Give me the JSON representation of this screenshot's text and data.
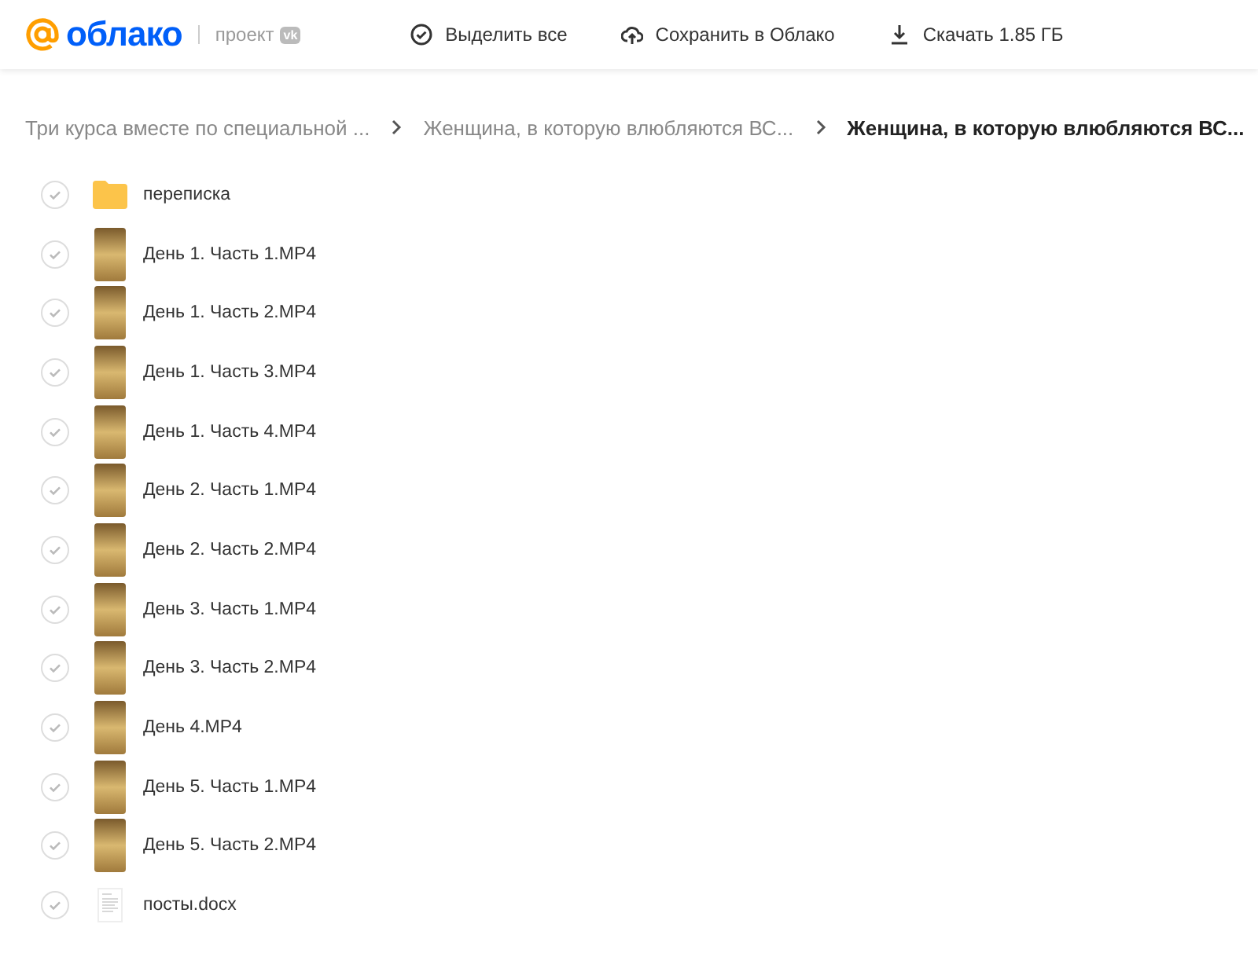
{
  "header": {
    "logo_text": "облако",
    "logo_sub": "проект",
    "vk_badge": "vk",
    "actions": [
      {
        "kind": "select",
        "label": "Выделить все"
      },
      {
        "kind": "save",
        "label": "Сохранить в Облако"
      },
      {
        "kind": "download",
        "label": "Скачать 1.85 ГБ"
      }
    ]
  },
  "breadcrumbs": [
    {
      "label": "Три курса вместе по специальной ...",
      "selected": false
    },
    {
      "label": "Женщина, в которую влюбляются ВС...",
      "selected": false
    },
    {
      "label": "Женщина, в которую влюбляются ВС...",
      "selected": true
    }
  ],
  "files": [
    {
      "kind": "folder",
      "name": "переписка",
      "selected": false
    },
    {
      "kind": "video",
      "name": "День 1. Часть 1.MP4",
      "selected": false
    },
    {
      "kind": "video",
      "name": "День 1. Часть 2.MP4",
      "selected": false
    },
    {
      "kind": "video",
      "name": "День 1. Часть 3.MP4",
      "selected": false
    },
    {
      "kind": "video",
      "name": "День 1. Часть 4.MP4",
      "selected": false
    },
    {
      "kind": "video",
      "name": "День 2. Часть 1.MP4",
      "selected": false
    },
    {
      "kind": "video",
      "name": "День 2. Часть 2.MP4",
      "selected": false
    },
    {
      "kind": "video",
      "name": "День 3. Часть 1.MP4",
      "selected": false
    },
    {
      "kind": "video",
      "name": "День 3. Часть 2.MP4",
      "selected": false
    },
    {
      "kind": "video",
      "name": "День 4.MP4",
      "selected": false
    },
    {
      "kind": "video",
      "name": "День 5. Часть 1.MP4",
      "selected": false
    },
    {
      "kind": "video",
      "name": "День 5. Часть 2.MP4",
      "selected": false
    },
    {
      "kind": "doc",
      "name": "посты.docx",
      "selected": false
    }
  ]
}
